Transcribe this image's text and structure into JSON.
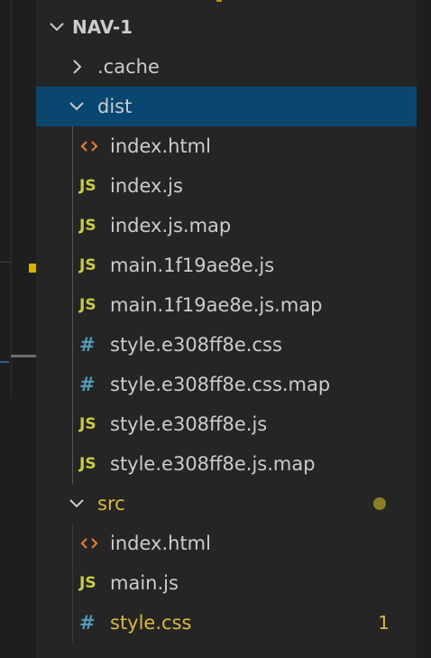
{
  "explorer": {
    "root": "NAV-1",
    "items": [
      {
        "label": ".cache",
        "type": "folder",
        "state": "collapsed"
      },
      {
        "label": "dist",
        "type": "folder",
        "state": "expanded",
        "selected": true
      },
      {
        "label": "index.html",
        "type": "html",
        "parent": "dist"
      },
      {
        "label": "index.js",
        "type": "js",
        "parent": "dist"
      },
      {
        "label": "index.js.map",
        "type": "js",
        "parent": "dist"
      },
      {
        "label": "main.1f19ae8e.js",
        "type": "js",
        "parent": "dist"
      },
      {
        "label": "main.1f19ae8e.js.map",
        "type": "js",
        "parent": "dist"
      },
      {
        "label": "style.e308ff8e.css",
        "type": "css",
        "parent": "dist"
      },
      {
        "label": "style.e308ff8e.css.map",
        "type": "css",
        "parent": "dist"
      },
      {
        "label": "style.e308ff8e.js",
        "type": "js",
        "parent": "dist"
      },
      {
        "label": "style.e308ff8e.js.map",
        "type": "js",
        "parent": "dist"
      },
      {
        "label": "src",
        "type": "folder",
        "state": "expanded",
        "modified": true
      },
      {
        "label": "index.html",
        "type": "html",
        "parent": "src"
      },
      {
        "label": "main.js",
        "type": "js",
        "parent": "src"
      },
      {
        "label": "style.css",
        "type": "css",
        "parent": "src",
        "modified": true,
        "badge": "1"
      }
    ]
  },
  "icons": {
    "js_glyph": "JS",
    "css_glyph": "#"
  },
  "colors": {
    "selection": "#094771",
    "js": "#cbcb41",
    "css": "#519aba",
    "html": "#e37933",
    "modified": "#d7ba3d",
    "modified_dot": "#8a7d25"
  }
}
